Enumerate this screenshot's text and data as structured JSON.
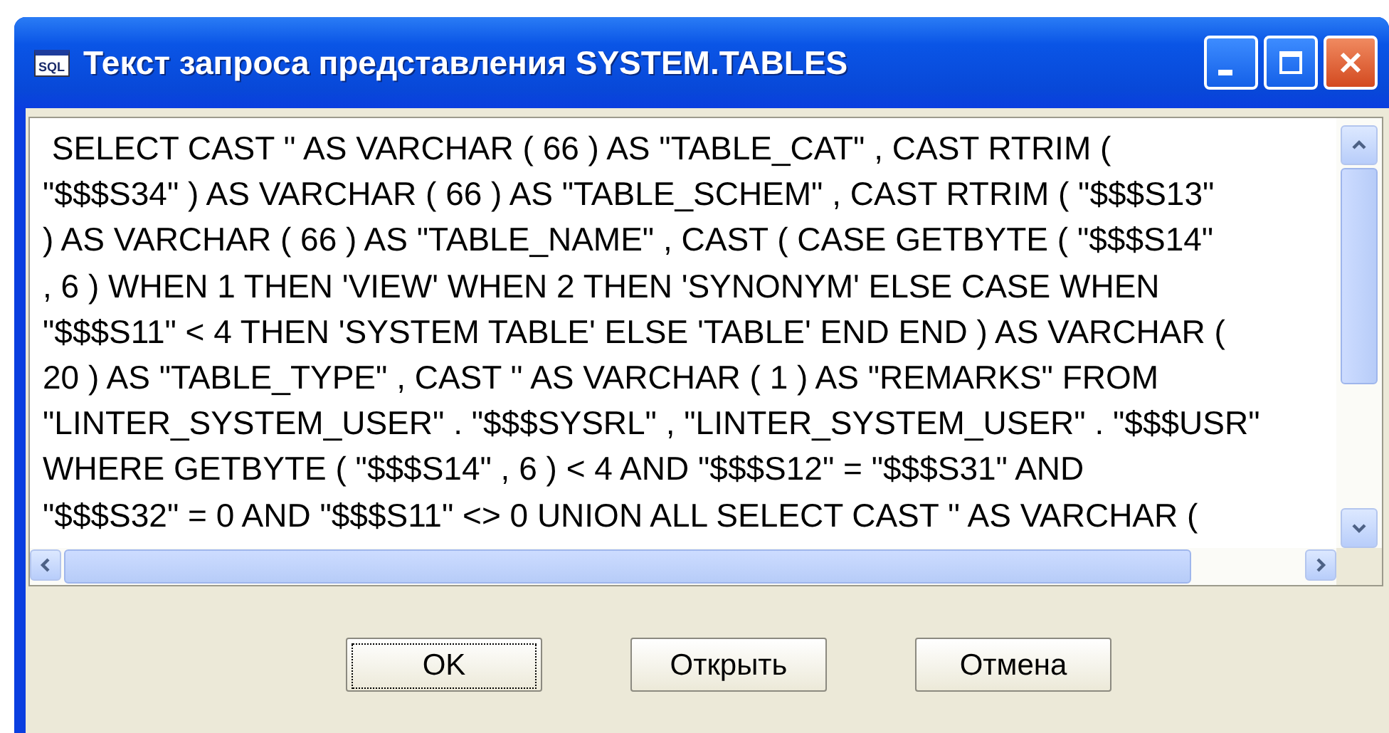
{
  "window": {
    "title": "Текст запроса представления SYSTEM.TABLES",
    "icon_text": "SQL"
  },
  "query_lines": [
    " SELECT CAST '' AS VARCHAR ( 66 ) AS \"TABLE_CAT\" , CAST RTRIM (",
    "\"$$$S34\" ) AS VARCHAR ( 66 ) AS \"TABLE_SCHEM\" , CAST RTRIM ( \"$$$S13\"",
    ") AS VARCHAR ( 66 ) AS \"TABLE_NAME\" , CAST ( CASE GETBYTE ( \"$$$S14\"",
    ", 6 ) WHEN 1 THEN 'VIEW' WHEN 2 THEN 'SYNONYM' ELSE CASE WHEN",
    "\"$$$S11\" < 4 THEN 'SYSTEM TABLE' ELSE 'TABLE' END END ) AS VARCHAR (",
    "20 ) AS \"TABLE_TYPE\" , CAST '' AS VARCHAR ( 1 ) AS \"REMARKS\" FROM",
    "\"LINTER_SYSTEM_USER\" . \"$$$SYSRL\" , \"LINTER_SYSTEM_USER\" . \"$$$USR\"",
    "WHERE GETBYTE ( \"$$$S14\" , 6 ) < 4 AND \"$$$S12\" = \"$$$S31\" AND",
    "\"$$$S32\" = 0 AND \"$$$S11\" <> 0 UNION ALL SELECT CAST '' AS VARCHAR ("
  ],
  "buttons": [
    {
      "label": "OK",
      "focused": true
    },
    {
      "label": "Открыть",
      "focused": false
    },
    {
      "label": "Отмена",
      "focused": false
    }
  ]
}
